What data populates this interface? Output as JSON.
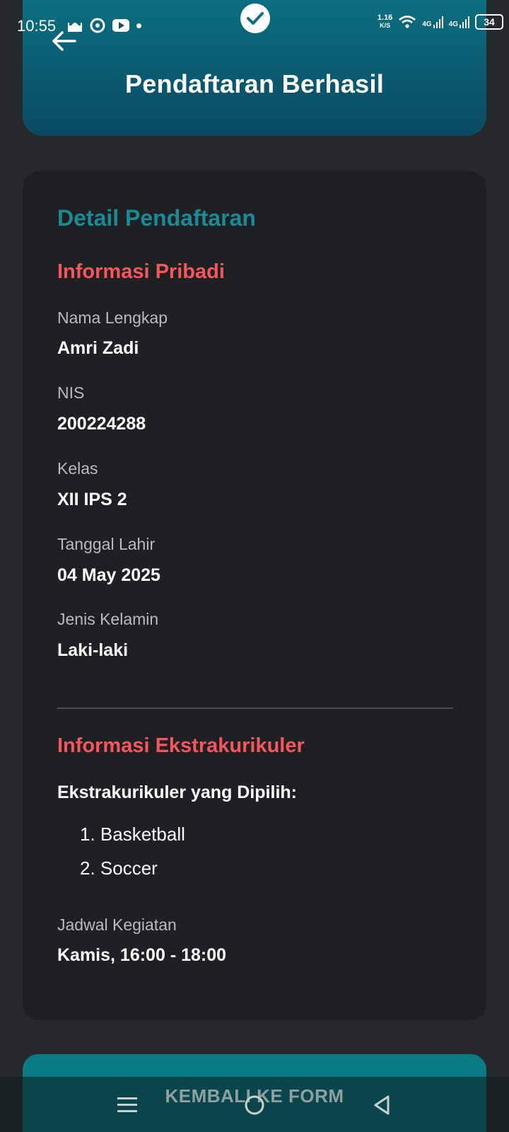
{
  "status_bar": {
    "time": "10:55",
    "speed_value": "1.16",
    "speed_unit": "K/S",
    "network_1": "4G",
    "network_2": "4G",
    "battery": "34"
  },
  "header": {
    "title": "Pendaftaran Berhasil"
  },
  "card": {
    "title": "Detail Pendaftaran",
    "personal_section": {
      "title": "Informasi Pribadi",
      "fields": [
        {
          "label": "Nama Lengkap",
          "value": "Amri Zadi"
        },
        {
          "label": "NIS",
          "value": "200224288"
        },
        {
          "label": "Kelas",
          "value": "XII IPS 2"
        },
        {
          "label": "Tanggal Lahir",
          "value": "04 May 2025"
        },
        {
          "label": "Jenis Kelamin",
          "value": "Laki-laki"
        }
      ]
    },
    "extracurricular_section": {
      "title": "Informasi Ekstrakurikuler",
      "chosen_label": "Ekstrakurikuler yang Dipilih:",
      "items": [
        "1. Basketball",
        "2. Soccer"
      ],
      "schedule_label": "Jadwal Kegiatan",
      "schedule_value": "Kamis, 16:00 - 18:00"
    }
  },
  "bottom_button": {
    "label": "KEMBALI KE FORM"
  },
  "colors": {
    "background": "#27282c",
    "card": "#1f2024",
    "accent_teal": "#1a8a95",
    "section_red": "#f4575b",
    "header_gradient_top": "#0b6f80",
    "button": "#0a7a85"
  }
}
